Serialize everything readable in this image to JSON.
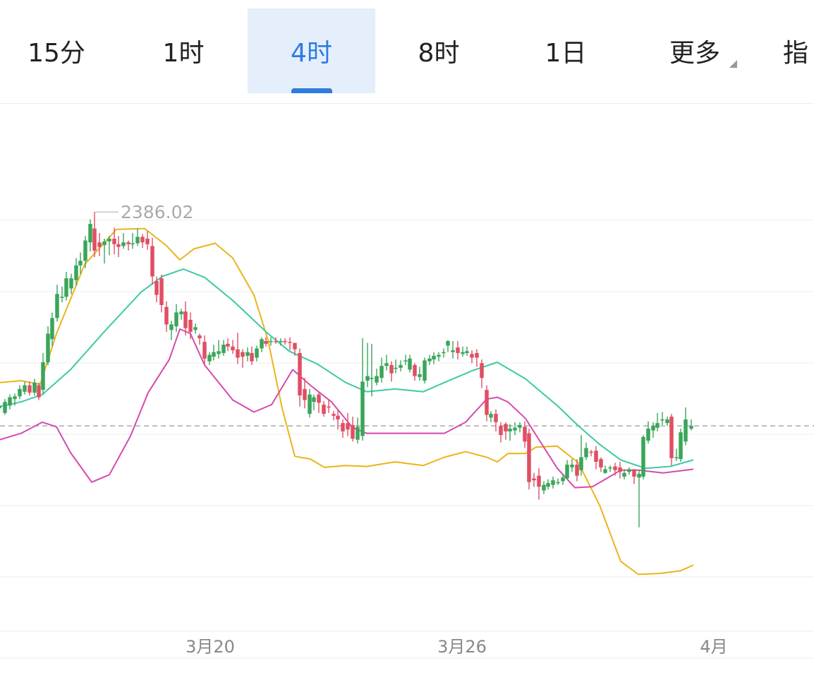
{
  "tabs": [
    {
      "label": "15分",
      "active": false
    },
    {
      "label": "1时",
      "active": false
    },
    {
      "label": "4时",
      "active": true
    },
    {
      "label": "8时",
      "active": false
    },
    {
      "label": "1日",
      "active": false
    },
    {
      "label": "更多",
      "active": false,
      "dropdown": true
    },
    {
      "label": "指",
      "active": false
    }
  ],
  "colors": {
    "up": "#3aa55a",
    "down": "#df4f64",
    "upper_band": "#e9b51c",
    "middle_band": "#3dcaa5",
    "lower_band": "#d44bae",
    "active_tab": "#2f7be0",
    "grid": "#eeeeee",
    "reference_line": "#aaaaaa"
  },
  "chart_data": {
    "type": "candlestick",
    "indicator": "bollinger bands",
    "max_label": "2386.02",
    "x_tick_labels": [
      "3月20",
      "3月26",
      "4月"
    ],
    "grid": true,
    "ylim": [
      2033,
      2546
    ],
    "series": [
      {
        "color_key": "upper_band",
        "points": [
          [
            0,
            2243
          ],
          [
            30,
            2245
          ],
          [
            57,
            2241
          ],
          [
            80,
            2296
          ],
          [
            120,
            2371
          ],
          [
            165,
            2409
          ],
          [
            205,
            2410
          ],
          [
            235,
            2392
          ],
          [
            255,
            2376
          ],
          [
            275,
            2388
          ],
          [
            305,
            2394
          ],
          [
            330,
            2378
          ],
          [
            360,
            2338
          ],
          [
            380,
            2289
          ],
          [
            400,
            2215
          ],
          [
            418,
            2163
          ],
          [
            440,
            2160
          ],
          [
            460,
            2151
          ],
          [
            490,
            2153
          ],
          [
            520,
            2152
          ],
          [
            560,
            2157
          ],
          [
            600,
            2153
          ],
          [
            630,
            2162
          ],
          [
            660,
            2168
          ],
          [
            690,
            2162
          ],
          [
            705,
            2157
          ],
          [
            720,
            2166
          ],
          [
            745,
            2166
          ],
          [
            760,
            2173
          ],
          [
            790,
            2174
          ],
          [
            820,
            2156
          ],
          [
            850,
            2110
          ],
          [
            880,
            2049
          ],
          [
            905,
            2035
          ],
          [
            935,
            2036
          ],
          [
            965,
            2039
          ],
          [
            983,
            2045
          ]
        ]
      },
      {
        "color_key": "middle_band",
        "points": [
          [
            0,
            2217
          ],
          [
            30,
            2222
          ],
          [
            60,
            2230
          ],
          [
            100,
            2257
          ],
          [
            150,
            2300
          ],
          [
            200,
            2341
          ],
          [
            230,
            2358
          ],
          [
            260,
            2366
          ],
          [
            290,
            2357
          ],
          [
            330,
            2332
          ],
          [
            380,
            2296
          ],
          [
            410,
            2277
          ],
          [
            450,
            2263
          ],
          [
            490,
            2243
          ],
          [
            520,
            2233
          ],
          [
            560,
            2236
          ],
          [
            600,
            2233
          ],
          [
            630,
            2243
          ],
          [
            670,
            2256
          ],
          [
            705,
            2265
          ],
          [
            745,
            2247
          ],
          [
            790,
            2218
          ],
          [
            820,
            2196
          ],
          [
            850,
            2176
          ],
          [
            880,
            2159
          ],
          [
            915,
            2150
          ],
          [
            950,
            2152
          ],
          [
            983,
            2159
          ]
        ]
      },
      {
        "color_key": "lower_band",
        "points": [
          [
            0,
            2181
          ],
          [
            30,
            2188
          ],
          [
            60,
            2200
          ],
          [
            80,
            2195
          ],
          [
            100,
            2167
          ],
          [
            130,
            2135
          ],
          [
            155,
            2143
          ],
          [
            185,
            2185
          ],
          [
            210,
            2232
          ],
          [
            240,
            2268
          ],
          [
            255,
            2301
          ],
          [
            270,
            2296
          ],
          [
            290,
            2262
          ],
          [
            330,
            2224
          ],
          [
            360,
            2211
          ],
          [
            385,
            2219
          ],
          [
            415,
            2257
          ],
          [
            440,
            2240
          ],
          [
            470,
            2222
          ],
          [
            500,
            2194
          ],
          [
            520,
            2188
          ],
          [
            560,
            2188
          ],
          [
            600,
            2188
          ],
          [
            630,
            2188
          ],
          [
            660,
            2200
          ],
          [
            690,
            2225
          ],
          [
            705,
            2227
          ],
          [
            720,
            2222
          ],
          [
            745,
            2204
          ],
          [
            790,
            2150
          ],
          [
            815,
            2129
          ],
          [
            840,
            2130
          ],
          [
            860,
            2139
          ],
          [
            880,
            2148
          ],
          [
            905,
            2148
          ],
          [
            940,
            2145
          ],
          [
            983,
            2149
          ]
        ]
      }
    ],
    "candles": [
      [
        -1,
        2215,
        2218,
        2209,
        2220
      ],
      [
        7,
        2210,
        2222,
        2208,
        2225
      ],
      [
        14,
        2218,
        2227,
        2214,
        2230
      ],
      [
        21,
        2225,
        2228,
        2218,
        2231
      ],
      [
        28,
        2228,
        2236,
        2225,
        2240
      ],
      [
        35,
        2233,
        2240,
        2230,
        2244
      ],
      [
        42,
        2240,
        2232,
        2229,
        2244
      ],
      [
        49,
        2232,
        2243,
        2229,
        2247
      ],
      [
        55,
        2240,
        2227,
        2224,
        2243
      ],
      [
        61,
        2235,
        2265,
        2230,
        2275
      ],
      [
        68,
        2265,
        2296,
        2262,
        2304
      ],
      [
        74,
        2290,
        2313,
        2282,
        2319
      ],
      [
        81,
        2313,
        2339,
        2309,
        2349
      ],
      [
        88,
        2336,
        2336,
        2330,
        2347
      ],
      [
        94,
        2336,
        2356,
        2332,
        2363
      ],
      [
        101,
        2345,
        2356,
        2339,
        2361
      ],
      [
        108,
        2354,
        2370,
        2348,
        2378
      ],
      [
        114,
        2370,
        2375,
        2361,
        2384
      ],
      [
        121,
        2375,
        2397,
        2367,
        2402
      ],
      [
        128,
        2395,
        2415,
        2385,
        2420
      ],
      [
        134,
        2410,
        2386,
        2379,
        2428
      ],
      [
        141,
        2395,
        2390,
        2380,
        2405
      ],
      [
        148,
        2392,
        2396,
        2372,
        2399
      ],
      [
        155,
        2396,
        2399,
        2381,
        2402
      ],
      [
        162,
        2399,
        2393,
        2382,
        2411
      ],
      [
        168,
        2393,
        2390,
        2379,
        2402
      ],
      [
        175,
        2391,
        2395,
        2388,
        2405
      ],
      [
        182,
        2395,
        2393,
        2386,
        2397
      ],
      [
        188,
        2393,
        2394,
        2388,
        2405
      ],
      [
        195,
        2394,
        2401,
        2391,
        2410
      ],
      [
        202,
        2401,
        2395,
        2389,
        2404
      ],
      [
        209,
        2399,
        2393,
        2387,
        2407
      ],
      [
        216,
        2391,
        2358,
        2349,
        2400
      ],
      [
        222,
        2353,
        2338,
        2330,
        2358
      ],
      [
        229,
        2356,
        2327,
        2319,
        2360
      ],
      [
        236,
        2325,
        2306,
        2298,
        2331
      ],
      [
        243,
        2300,
        2306,
        2289,
        2310
      ],
      [
        250,
        2304,
        2319,
        2298,
        2328
      ],
      [
        257,
        2317,
        2320,
        2311,
        2323
      ],
      [
        263,
        2320,
        2302,
        2294,
        2331
      ],
      [
        270,
        2311,
        2298,
        2290,
        2319
      ],
      [
        277,
        2300,
        2303,
        2296,
        2307
      ],
      [
        283,
        2294,
        2291,
        2284,
        2296
      ],
      [
        290,
        2287,
        2269,
        2262,
        2294
      ],
      [
        297,
        2266,
        2273,
        2262,
        2276
      ],
      [
        303,
        2271,
        2276,
        2267,
        2284
      ],
      [
        310,
        2274,
        2277,
        2269,
        2289
      ],
      [
        317,
        2275,
        2284,
        2272,
        2289
      ],
      [
        323,
        2285,
        2282,
        2277,
        2291
      ],
      [
        330,
        2282,
        2278,
        2274,
        2289
      ],
      [
        337,
        2279,
        2270,
        2263,
        2297
      ],
      [
        344,
        2276,
        2271,
        2259,
        2279
      ],
      [
        351,
        2272,
        2276,
        2266,
        2281
      ],
      [
        357,
        2275,
        2266,
        2262,
        2282
      ],
      [
        364,
        2270,
        2280,
        2266,
        2283
      ],
      [
        371,
        2280,
        2290,
        2276,
        2292
      ],
      [
        377,
        2288,
        2285,
        2282,
        2292
      ],
      [
        384,
        2287,
        2288,
        2283,
        2292
      ],
      [
        391,
        2288,
        2287,
        2285,
        2292
      ],
      [
        398,
        2287,
        2288,
        2283,
        2291
      ],
      [
        404,
        2288,
        2287,
        2284,
        2291
      ],
      [
        411,
        2287,
        2286,
        2278,
        2292
      ],
      [
        418,
        2286,
        2279,
        2272,
        2286
      ],
      [
        425,
        2275,
        2229,
        2217,
        2280
      ],
      [
        432,
        2236,
        2224,
        2215,
        2248
      ],
      [
        439,
        2209,
        2230,
        2205,
        2236
      ],
      [
        445,
        2222,
        2227,
        2213,
        2230
      ],
      [
        452,
        2230,
        2221,
        2210,
        2233
      ],
      [
        459,
        2219,
        2209,
        2206,
        2223
      ],
      [
        466,
        2217,
        2216,
        2210,
        2225
      ],
      [
        473,
        2209,
        2207,
        2202,
        2212
      ],
      [
        479,
        2207,
        2203,
        2192,
        2213
      ],
      [
        486,
        2199,
        2190,
        2183,
        2203
      ],
      [
        493,
        2199,
        2192,
        2185,
        2210
      ],
      [
        500,
        2197,
        2182,
        2179,
        2206
      ],
      [
        507,
        2181,
        2195,
        2177,
        2205
      ],
      [
        514,
        2185,
        2244,
        2180,
        2291
      ],
      [
        521,
        2245,
        2250,
        2238,
        2286
      ],
      [
        527,
        2247,
        2248,
        2228,
        2285
      ],
      [
        534,
        2243,
        2250,
        2240,
        2258
      ],
      [
        541,
        2248,
        2261,
        2243,
        2270
      ],
      [
        548,
        2261,
        2264,
        2256,
        2273
      ],
      [
        555,
        2262,
        2253,
        2244,
        2266
      ],
      [
        561,
        2259,
        2259,
        2253,
        2268
      ],
      [
        568,
        2259,
        2262,
        2255,
        2267
      ],
      [
        575,
        2267,
        2267,
        2262,
        2273
      ],
      [
        581,
        2257,
        2269,
        2254,
        2273
      ],
      [
        588,
        2262,
        2250,
        2245,
        2264
      ],
      [
        595,
        2249,
        2252,
        2245,
        2260
      ],
      [
        602,
        2245,
        2267,
        2242,
        2270
      ],
      [
        609,
        2266,
        2269,
        2262,
        2273
      ],
      [
        615,
        2268,
        2272,
        2263,
        2276
      ],
      [
        622,
        2271,
        2273,
        2266,
        2276
      ],
      [
        629,
        2276,
        2276,
        2270,
        2280
      ],
      [
        635,
        2283,
        2288,
        2276,
        2289
      ],
      [
        642,
        2276,
        2278,
        2269,
        2288
      ],
      [
        649,
        2281,
        2275,
        2268,
        2288
      ],
      [
        656,
        2274,
        2276,
        2271,
        2282
      ],
      [
        662,
        2275,
        2277,
        2272,
        2282
      ],
      [
        669,
        2274,
        2270,
        2264,
        2278
      ],
      [
        676,
        2275,
        2270,
        2260,
        2279
      ],
      [
        683,
        2264,
        2248,
        2237,
        2268
      ],
      [
        690,
        2235,
        2208,
        2201,
        2240
      ],
      [
        696,
        2205,
        2209,
        2200,
        2212
      ],
      [
        703,
        2209,
        2200,
        2190,
        2214
      ],
      [
        710,
        2196,
        2186,
        2178,
        2200
      ],
      [
        717,
        2198,
        2190,
        2181,
        2200
      ],
      [
        723,
        2190,
        2193,
        2180,
        2198
      ],
      [
        730,
        2191,
        2194,
        2186,
        2200
      ],
      [
        737,
        2194,
        2197,
        2189,
        2200
      ],
      [
        744,
        2195,
        2179,
        2172,
        2201
      ],
      [
        750,
        2188,
        2135,
        2127,
        2193
      ],
      [
        757,
        2139,
        2137,
        2130,
        2145
      ],
      [
        764,
        2142,
        2130,
        2116,
        2150
      ],
      [
        771,
        2126,
        2132,
        2122,
        2136
      ],
      [
        777,
        2130,
        2134,
        2127,
        2138
      ],
      [
        784,
        2132,
        2137,
        2128,
        2141
      ],
      [
        791,
        2135,
        2135,
        2132,
        2139
      ],
      [
        798,
        2136,
        2140,
        2132,
        2144
      ],
      [
        804,
        2139,
        2154,
        2138,
        2159
      ],
      [
        811,
        2151,
        2154,
        2146,
        2160
      ],
      [
        818,
        2154,
        2142,
        2136,
        2160
      ],
      [
        824,
        2148,
        2162,
        2142,
        2186
      ],
      [
        831,
        2162,
        2172,
        2159,
        2178
      ],
      [
        838,
        2168,
        2167,
        2163,
        2170
      ],
      [
        845,
        2169,
        2157,
        2149,
        2174
      ],
      [
        852,
        2160,
        2151,
        2146,
        2162
      ],
      [
        858,
        2145,
        2149,
        2144,
        2153
      ],
      [
        865,
        2150,
        2151,
        2146,
        2153
      ],
      [
        872,
        2152,
        2148,
        2142,
        2156
      ],
      [
        879,
        2151,
        2146,
        2139,
        2157
      ],
      [
        885,
        2141,
        2145,
        2138,
        2149
      ],
      [
        892,
        2146,
        2149,
        2143,
        2151
      ],
      [
        899,
        2149,
        2141,
        2133,
        2149
      ],
      [
        906,
        2140,
        2144,
        2086,
        2148
      ],
      [
        912,
        2141,
        2184,
        2138,
        2186
      ],
      [
        919,
        2180,
        2193,
        2177,
        2201
      ],
      [
        926,
        2191,
        2196,
        2183,
        2200
      ],
      [
        932,
        2194,
        2199,
        2190,
        2210
      ],
      [
        939,
        2203,
        2203,
        2197,
        2211
      ],
      [
        946,
        2199,
        2203,
        2196,
        2206
      ],
      [
        952,
        2206,
        2161,
        2153,
        2209
      ],
      [
        959,
        2162,
        2162,
        2158,
        2171
      ],
      [
        965,
        2160,
        2189,
        2157,
        2193
      ],
      [
        972,
        2179,
        2203,
        2175,
        2216
      ],
      [
        980,
        2193,
        2196,
        2191,
        2203
      ]
    ]
  }
}
